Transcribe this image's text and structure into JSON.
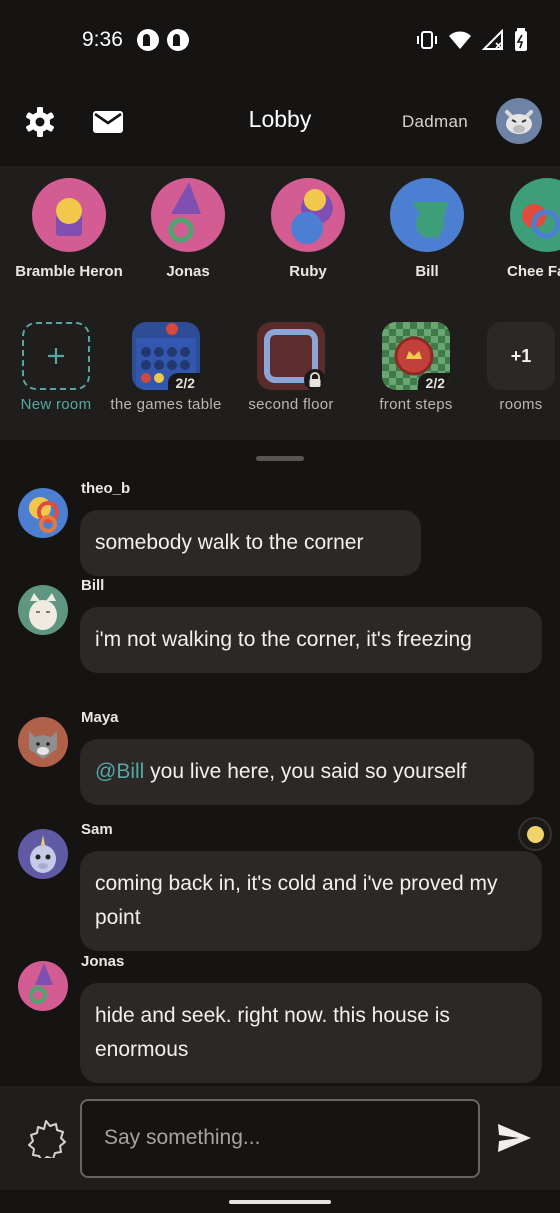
{
  "status_bar": {
    "time": "9:36"
  },
  "header": {
    "title": "Lobby",
    "username": "Dadman"
  },
  "people": [
    {
      "name": "Bramble Heron"
    },
    {
      "name": "Jonas"
    },
    {
      "name": "Ruby"
    },
    {
      "name": "Bill"
    },
    {
      "name": "Chee Falco"
    }
  ],
  "rooms": [
    {
      "label": "New room"
    },
    {
      "label": "the games table",
      "count": "2/2"
    },
    {
      "label": "second floor"
    },
    {
      "label": "front steps",
      "count": "2/2"
    },
    {
      "label": "rooms",
      "count": "+1"
    }
  ],
  "messages": [
    {
      "user": "theo_b",
      "text": "somebody walk to the corner"
    },
    {
      "user": "Bill",
      "text": "i'm not walking to the corner, it's freezing"
    },
    {
      "user": "Maya",
      "mention": "@Bill",
      "text": " you live here, you said so yourself"
    },
    {
      "user": "Sam",
      "text": "coming back in, it's cold and i've proved my point",
      "reaction": "emoji"
    },
    {
      "user": "Jonas",
      "text": "hide and seek. right now. this house is enormous"
    }
  ],
  "composer": {
    "placeholder": "Say something..."
  },
  "colors": {
    "accent": "#55a7a3",
    "background": "#161413",
    "panel": "#201e1c",
    "bubble": "#2b2826"
  }
}
